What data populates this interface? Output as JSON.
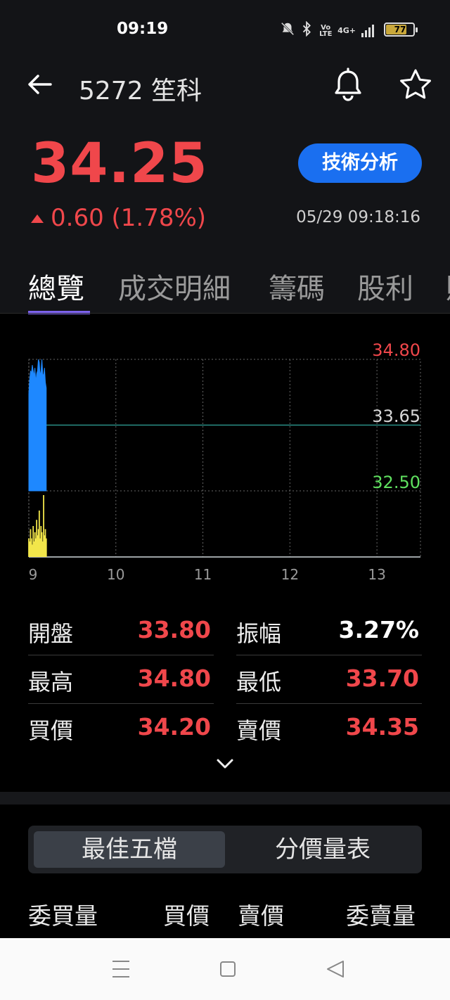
{
  "status_bar": {
    "time": "09:19",
    "network": "4G+",
    "volte": "Vo LTE",
    "battery": "77"
  },
  "header": {
    "title": "5272 笙科"
  },
  "quote": {
    "price": "34.25",
    "change": "0.60 (1.78%)",
    "datetime": "05/29 09:18:16",
    "tech_button": "技術分析",
    "up_color": "#f0474b"
  },
  "tabs": [
    {
      "label": "總覽",
      "active": true
    },
    {
      "label": "成交明細"
    },
    {
      "label": "籌碼"
    },
    {
      "label": "股利"
    },
    {
      "label": "財"
    }
  ],
  "chart_data": {
    "type": "area",
    "y_labels": {
      "high": "34.80",
      "ref": "33.65",
      "low": "32.50"
    },
    "ylim": [
      32.5,
      34.8
    ],
    "reference": 33.65,
    "x_ticks": [
      "9",
      "10",
      "11",
      "12",
      "13"
    ],
    "xlim": [
      9,
      13.5
    ],
    "price_color": "#1e88ff",
    "volume_color": "#f2e64a",
    "price_series": [
      {
        "x": 9.0,
        "y": 34.2
      },
      {
        "x": 9.01,
        "y": 34.45
      },
      {
        "x": 9.02,
        "y": 34.6
      },
      {
        "x": 9.03,
        "y": 34.55
      },
      {
        "x": 9.04,
        "y": 34.7
      },
      {
        "x": 9.05,
        "y": 34.6
      },
      {
        "x": 9.06,
        "y": 34.5
      },
      {
        "x": 9.07,
        "y": 34.65
      },
      {
        "x": 9.08,
        "y": 34.4
      },
      {
        "x": 9.09,
        "y": 34.55
      },
      {
        "x": 9.1,
        "y": 34.6
      },
      {
        "x": 9.11,
        "y": 34.8
      },
      {
        "x": 9.12,
        "y": 34.75
      },
      {
        "x": 9.13,
        "y": 34.5
      },
      {
        "x": 9.14,
        "y": 34.6
      },
      {
        "x": 9.15,
        "y": 34.8
      },
      {
        "x": 9.16,
        "y": 34.55
      },
      {
        "x": 9.17,
        "y": 34.5
      },
      {
        "x": 9.18,
        "y": 34.65
      },
      {
        "x": 9.19,
        "y": 34.4
      },
      {
        "x": 9.2,
        "y": 34.3
      }
    ],
    "volume_series": [
      {
        "x": 9.0,
        "v": 0.3
      },
      {
        "x": 9.01,
        "v": 0.25
      },
      {
        "x": 9.02,
        "v": 0.45
      },
      {
        "x": 9.03,
        "v": 0.3
      },
      {
        "x": 9.04,
        "v": 0.2
      },
      {
        "x": 9.05,
        "v": 0.5
      },
      {
        "x": 9.06,
        "v": 0.25
      },
      {
        "x": 9.07,
        "v": 0.4
      },
      {
        "x": 9.08,
        "v": 0.3
      },
      {
        "x": 9.09,
        "v": 0.6
      },
      {
        "x": 9.1,
        "v": 0.35
      },
      {
        "x": 9.11,
        "v": 0.45
      },
      {
        "x": 9.12,
        "v": 0.75
      },
      {
        "x": 9.13,
        "v": 0.3
      },
      {
        "x": 9.14,
        "v": 0.5
      },
      {
        "x": 9.15,
        "v": 0.4
      },
      {
        "x": 9.16,
        "v": 0.25
      },
      {
        "x": 9.17,
        "v": 1.0
      },
      {
        "x": 9.18,
        "v": 0.35
      },
      {
        "x": 9.19,
        "v": 0.45
      },
      {
        "x": 9.2,
        "v": 0.3
      }
    ]
  },
  "stats": [
    {
      "left_label": "開盤",
      "left_value": "33.80",
      "right_label": "振幅",
      "right_value": "3.27%"
    },
    {
      "left_label": "最高",
      "left_value": "34.80",
      "right_label": "最低",
      "right_value": "33.70"
    },
    {
      "left_label": "買價",
      "left_value": "34.20",
      "right_label": "賣價",
      "right_value": "34.35"
    }
  ],
  "segments": [
    {
      "label": "最佳五檔",
      "active": true
    },
    {
      "label": "分價量表"
    }
  ],
  "orderbook_headers": [
    "委買量",
    "買價",
    "賣價",
    "委賣量"
  ]
}
